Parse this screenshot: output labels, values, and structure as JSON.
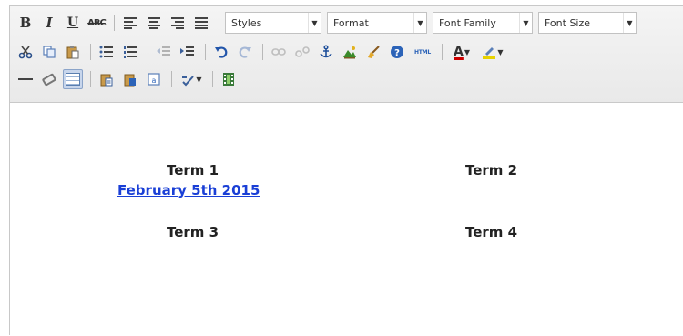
{
  "toolbar": {
    "row1": {
      "bold_label": "B",
      "italic_label": "I",
      "underline_label": "U",
      "strike_label": "ABC",
      "styles_select": "Styles",
      "format_select": "Format",
      "font_family_select": "Font Family",
      "font_size_select": "Font Size"
    },
    "row2": {
      "html_label": "HTML",
      "text_color_label": "A"
    }
  },
  "content": {
    "cells": [
      {
        "label": "Term 1"
      },
      {
        "label": "Term 2"
      },
      {
        "label": "Term 3"
      },
      {
        "label": "Term 4"
      }
    ],
    "link_text": "February 5th 2015"
  },
  "colors": {
    "link": "#1a3fd6",
    "toolbar_bg": "#eeeeee",
    "text": "#222222"
  }
}
